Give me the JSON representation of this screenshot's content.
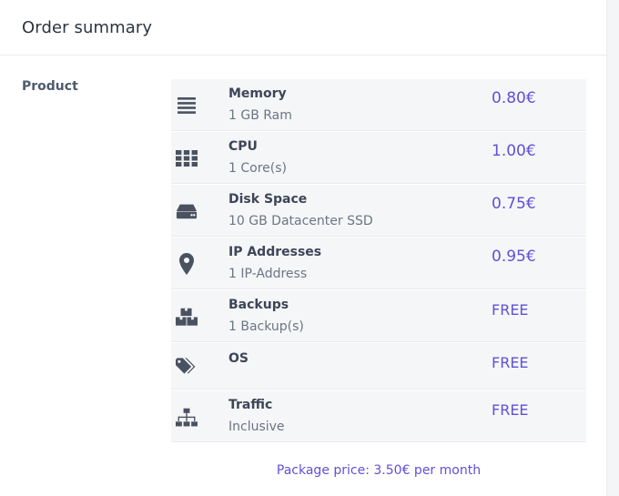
{
  "card": {
    "title": "Order summary"
  },
  "section": {
    "label": "Product"
  },
  "items": [
    {
      "name": "Memory",
      "description": "1 GB Ram",
      "price": "0.80€",
      "icon": "menu-lines-icon"
    },
    {
      "name": "CPU",
      "description": "1 Core(s)",
      "price": "1.00€",
      "icon": "grid-icon"
    },
    {
      "name": "Disk Space",
      "description": "10 GB Datacenter SSD",
      "price": "0.75€",
      "icon": "hard-drive-icon"
    },
    {
      "name": "IP Addresses",
      "description": "1 IP-Address",
      "price": "0.95€",
      "icon": "map-pin-icon"
    },
    {
      "name": "Backups",
      "description": "1 Backup(s)",
      "price": "FREE",
      "icon": "boxes-icon"
    },
    {
      "name": "OS",
      "description": "",
      "price": "FREE",
      "icon": "tags-icon"
    },
    {
      "name": "Traffic",
      "description": "Inclusive",
      "price": "FREE",
      "icon": "sitemap-icon"
    }
  ],
  "footer": {
    "package_price": "Package price: 3.50€ per month"
  },
  "colors": {
    "accent": "#6150d6",
    "row_bg": "#f5f6f8",
    "text_dark": "#3d4657"
  }
}
